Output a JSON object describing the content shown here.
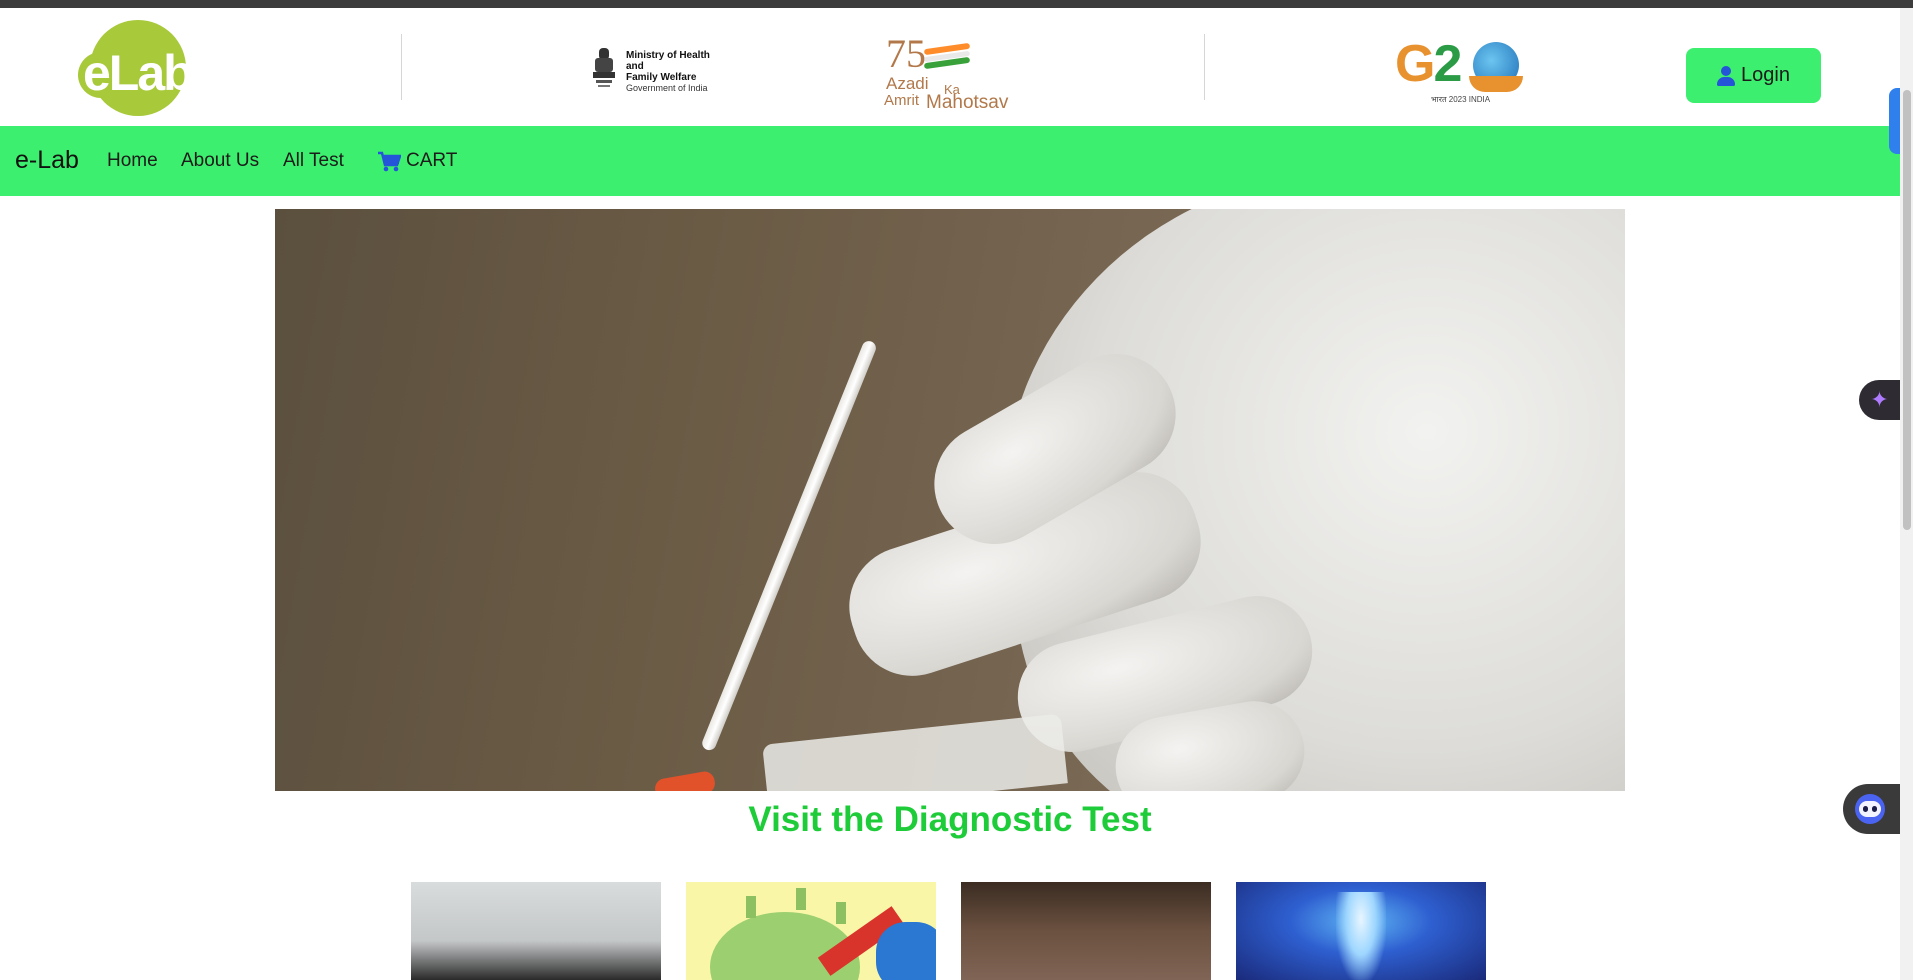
{
  "header": {
    "logo_text": "eLab",
    "ministry": {
      "line1": "Ministry of Health and",
      "line2": "Family Welfare",
      "line3": "Government of India"
    },
    "azadi": {
      "number": "75",
      "line1": "Azadi",
      "ka": "Ka",
      "line2": "Amrit",
      "line3": "Mahotsav"
    },
    "g20": {
      "g": "G",
      "two": "2",
      "sub": "भारत 2023 INDIA"
    },
    "login_label": "Login"
  },
  "navbar": {
    "brand": "e-Lab",
    "links": [
      {
        "label": "Home"
      },
      {
        "label": "About Us"
      },
      {
        "label": "All Test"
      }
    ],
    "cart_label": "CART"
  },
  "main": {
    "section_title": "Visit the Diagnostic Test"
  },
  "colors": {
    "nav_green": "#3def6e",
    "title_green": "#1ecc3a",
    "logo_green": "#a7c93a",
    "icon_blue": "#2454d8"
  },
  "icons": {
    "user": "user-icon",
    "cart": "cart-icon",
    "ai": "sparkle-icon",
    "bot": "chatbot-icon"
  }
}
